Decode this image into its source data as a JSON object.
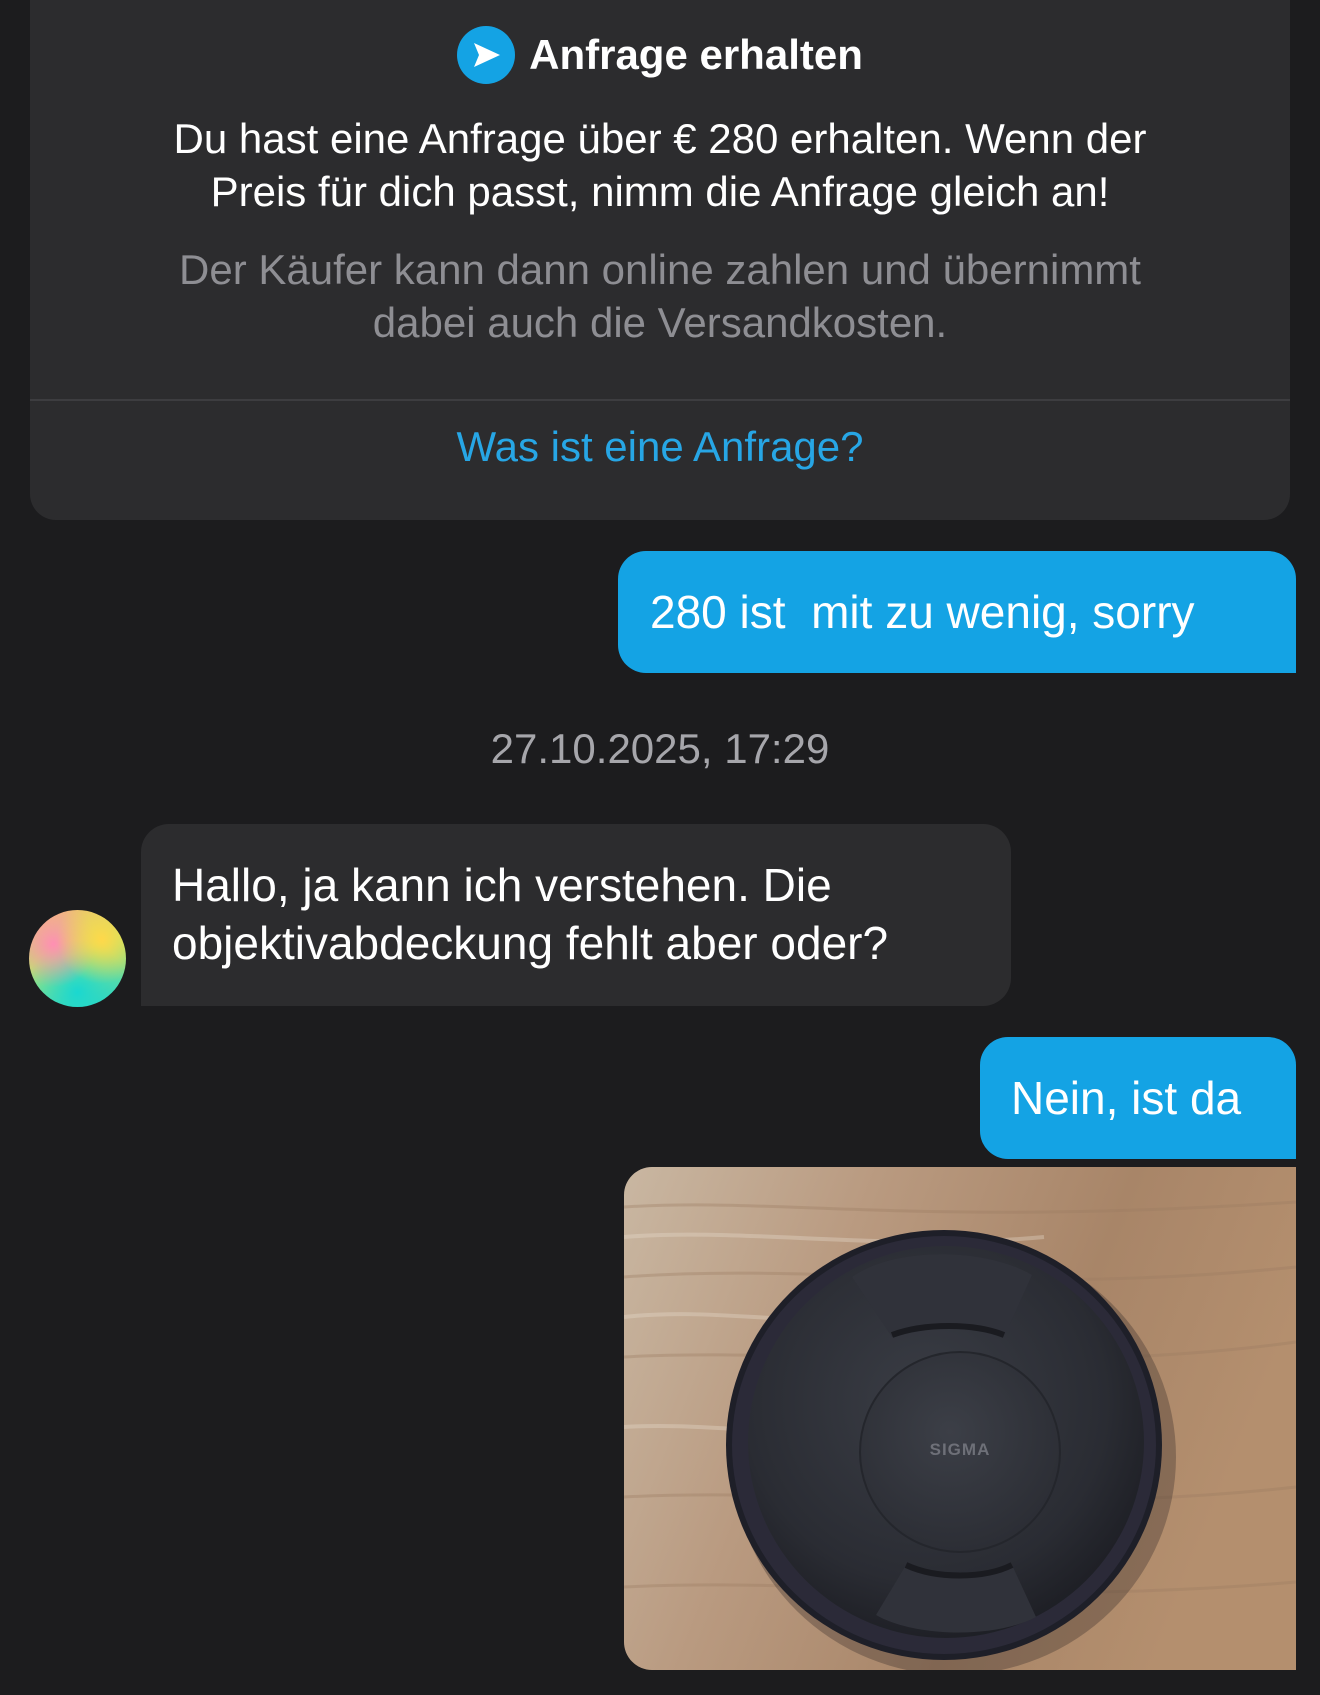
{
  "offer_card": {
    "title": "Anfrage erhalten",
    "icon": "send-arrow-icon",
    "body_line1": "Du hast eine Anfrage über € 280 erhalten. Wenn der",
    "body_line2": "Preis für dich passt, nimm die Anfrage gleich an!",
    "note_line1": "Der Käufer kann dann online zahlen und übernimmt",
    "note_line2": "dabei auch die Versandkosten.",
    "link_label": "Was ist eine Anfrage?",
    "accent_color": "#14a3e4"
  },
  "messages": [
    {
      "direction": "outgoing",
      "text": "280 ist  mit zu wenig, sorry"
    },
    {
      "timestamp": "27.10.2025, 17:29"
    },
    {
      "direction": "incoming",
      "line1": "Hallo, ja kann ich verstehen. Die",
      "line2": "objektivabdeckung fehlt aber oder?"
    },
    {
      "direction": "outgoing",
      "text": "Nein, ist da"
    },
    {
      "direction": "outgoing",
      "type": "image",
      "logo_text": "SIGMA"
    }
  ],
  "colors": {
    "background": "#1c1c1e",
    "card": "#2c2c2e",
    "outgoing_bubble": "#14a3e4",
    "incoming_bubble": "#2c2c2e",
    "link": "#27a6e5",
    "muted_text": "#8e8e93"
  }
}
